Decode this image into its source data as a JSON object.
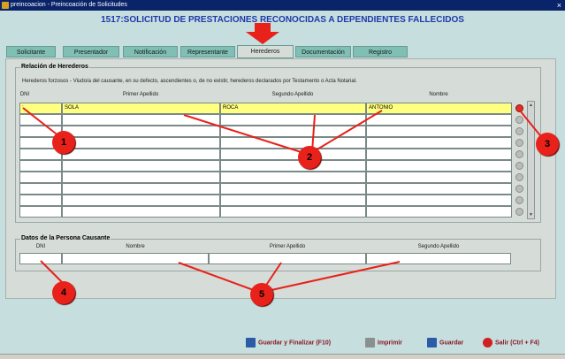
{
  "window": {
    "title": "preincoacion - Preincoación de Solicitudes",
    "close": "×"
  },
  "heading": "1517:SOLICITUD DE PRESTACIONES RECONOCIDAS A DEPENDIENTES FALLECIDOS",
  "tabs": [
    "Solicitante",
    "Presentador",
    "Notificación",
    "Representante",
    "Herederos",
    "Documentación",
    "Registro"
  ],
  "herederos": {
    "group_title": "Relación de Herederos",
    "note": "Herederos forzosos - Viudo/a del causante, en su defecto, ascendientes o, de no existir, herederos declarados por Testamento o Acta Notarial.",
    "columns": {
      "dni": "DNI",
      "primer": "Primer Apellido",
      "segundo": "Segundo Apellido",
      "nombre": "Nombre"
    },
    "row1": {
      "dni": ":",
      "primer": "SOLA",
      "segundo": "ROCA",
      "nombre": "ANTONIO"
    }
  },
  "causante": {
    "group_title": "Datos de la Persona Causante",
    "columns": {
      "dni": "DNI",
      "nombre": "Nombre",
      "primer": "Primer Apellido",
      "segundo": "Segundo Apellido"
    }
  },
  "callouts": [
    "1",
    "2",
    "3",
    "4",
    "5"
  ],
  "buttons": {
    "guardar_finalizar": "Guardar y Finalizar (F10)",
    "imprimir": "Imprimir",
    "guardar": "Guardar",
    "salir": "Salir (Ctrl + F4)"
  },
  "colors": {
    "heading": "#1f3aa8",
    "callout": "#e8211a",
    "highlight": "#ffff80",
    "tab": "#7fbfb4"
  }
}
